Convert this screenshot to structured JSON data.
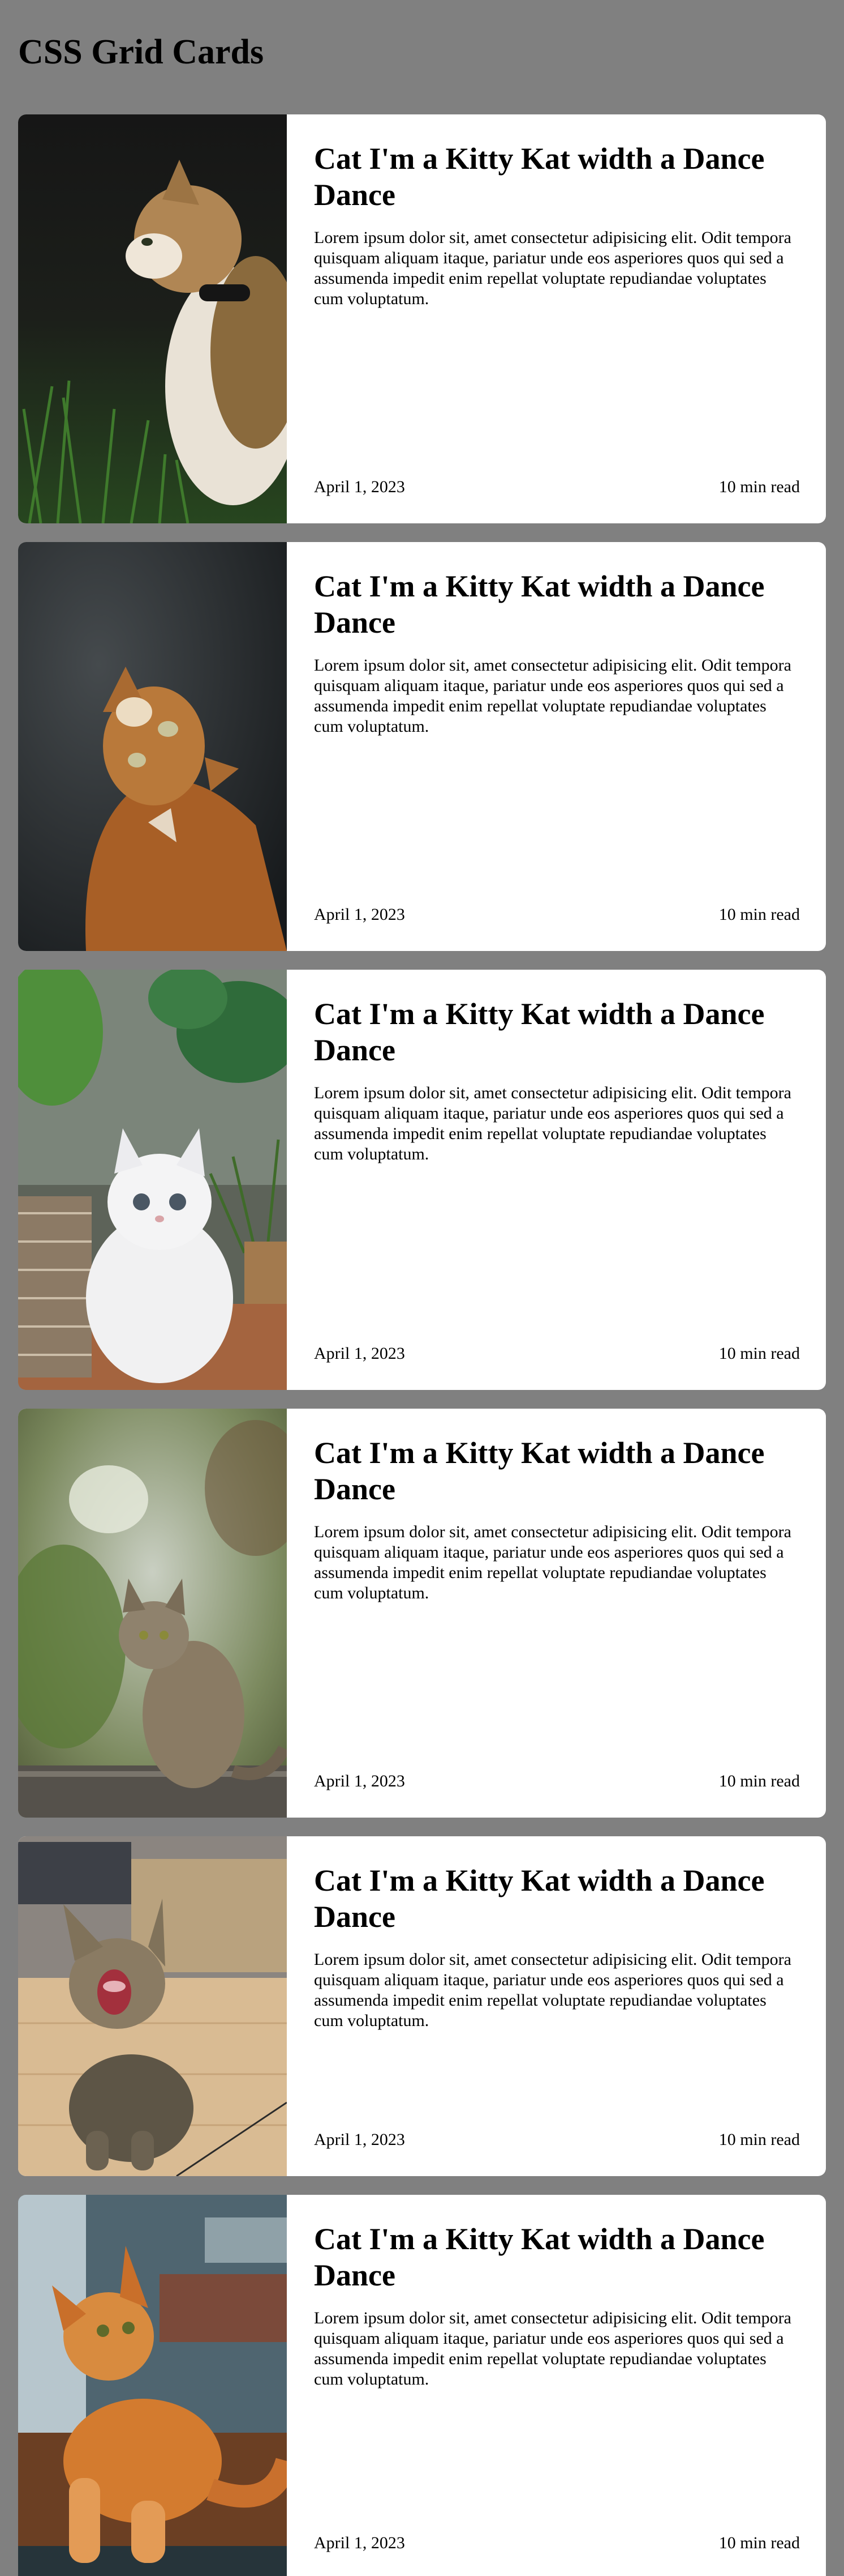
{
  "page": {
    "title": "CSS Grid Cards"
  },
  "cards": [
    {
      "title": "Cat I'm a Kitty Kat width a Dance Dance",
      "text": "Lorem ipsum dolor sit, amet consectetur adipisicing elit. Odit tempora quisquam aliquam itaque, pariatur unde eos asperiores quos qui sed a assumenda impedit enim repellat voluptate repudiandae voluptates cum voluptatum.",
      "date": "April 1, 2023",
      "read_time": "10 min read",
      "image": "calico cat in grass"
    },
    {
      "title": "Cat I'm a Kitty Kat width a Dance Dance",
      "text": "Lorem ipsum dolor sit, amet consectetur adipisicing elit. Odit tempora quisquam aliquam itaque, pariatur unde eos asperiores quos qui sed a assumenda impedit enim repellat voluptate repudiandae voluptates cum voluptatum.",
      "date": "April 1, 2023",
      "read_time": "10 min read",
      "image": "orange cat looking up"
    },
    {
      "title": "Cat I'm a Kitty Kat width a Dance Dance",
      "text": "Lorem ipsum dolor sit, amet consectetur adipisicing elit. Odit tempora quisquam aliquam itaque, pariatur unde eos asperiores quos qui sed a assumenda impedit enim repellat voluptate repudiandae voluptates cum voluptatum.",
      "date": "April 1, 2023",
      "read_time": "10 min read",
      "image": "white fluffy kitten with plants"
    },
    {
      "title": "Cat I'm a Kitty Kat width a Dance Dance",
      "text": "Lorem ipsum dolor sit, amet consectetur adipisicing elit. Odit tempora quisquam aliquam itaque, pariatur unde eos asperiores quos qui sed a assumenda impedit enim repellat voluptate repudiandae voluptates cum voluptatum.",
      "date": "April 1, 2023",
      "read_time": "10 min read",
      "image": "tabby cat sitting on log"
    },
    {
      "title": "Cat I'm a Kitty Kat width a Dance Dance",
      "text": "Lorem ipsum dolor sit, amet consectetur adipisicing elit. Odit tempora quisquam aliquam itaque, pariatur unde eos asperiores quos qui sed a assumenda impedit enim repellat voluptate repudiandae voluptates cum voluptatum.",
      "date": "April 1, 2023",
      "read_time": "10 min read",
      "image": "yawning tabby kitten on floor"
    },
    {
      "title": "Cat I'm a Kitty Kat width a Dance Dance",
      "text": "Lorem ipsum dolor sit, amet consectetur adipisicing elit. Odit tempora quisquam aliquam itaque, pariatur unde eos asperiores quos qui sed a assumenda impedit enim repellat voluptate repudiandae voluptates cum voluptatum.",
      "date": "April 1, 2023",
      "read_time": "10 min read",
      "image": "orange cat lying on table"
    }
  ]
}
